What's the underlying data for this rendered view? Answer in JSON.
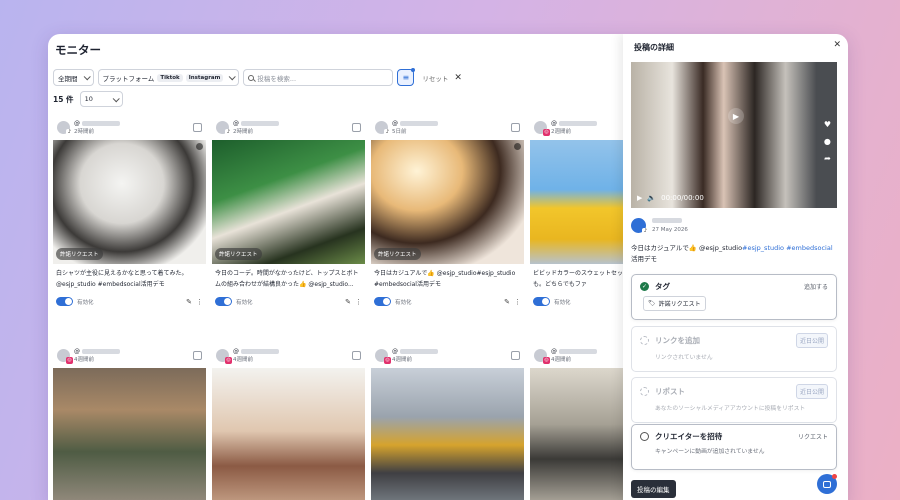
{
  "page": {
    "title": "モニター"
  },
  "filters": {
    "period": "全期間",
    "platform_label": "プラットフォーム",
    "platform_chips": [
      "Tiktok",
      "Instagram"
    ],
    "search_placeholder": "投稿を検索...",
    "reset": "リセット"
  },
  "results": {
    "count": "15 件",
    "per_page": "10"
  },
  "cards": [
    {
      "user": "@",
      "time": "2時間前",
      "platform": "tiktok",
      "badge": "許諾リクエスト",
      "caption": "白シャツが主役に見えるかなと思って着てみた。@esjp_studio #embedsocial活用デモ",
      "enabled": "有効化"
    },
    {
      "user": "@",
      "time": "2時間前",
      "platform": "tiktok",
      "badge": "許諾リクエスト",
      "caption": "今日のコーデ。時間がなかったけど、トップスとボトムの組み合わせが結構良かった👍 @esjp_studio...",
      "enabled": "有効化"
    },
    {
      "user": "@",
      "time": "5日前",
      "platform": "tiktok",
      "badge": "許諾リクエスト",
      "caption": "今日はカジュアルで👍 @esjp_studio#esjp_studio #embedsocial活用デモ",
      "enabled": "有効化"
    },
    {
      "user": "@",
      "time": "2週間前",
      "platform": "instagram",
      "badge": "",
      "caption": "ビビッドカラーのスウェットセットでもスポーツでも。どちらでもファ",
      "enabled": "有効化"
    },
    {
      "user": "@",
      "time": "4週間前",
      "platform": "instagram",
      "badge": "",
      "caption": "",
      "enabled": ""
    },
    {
      "user": "@",
      "time": "4週間前",
      "platform": "instagram",
      "badge": "",
      "caption": "",
      "enabled": ""
    },
    {
      "user": "@",
      "time": "4週間前",
      "platform": "instagram",
      "badge": "",
      "caption": "",
      "enabled": ""
    },
    {
      "user": "@",
      "time": "4週間前",
      "platform": "instagram",
      "badge": "",
      "caption": "",
      "enabled": ""
    }
  ],
  "panel": {
    "title": "投稿の詳細",
    "video_time": "00:00/00:00",
    "date": "27 May 2026",
    "caption_plain": "今日はカジュアルで👍 @esjp_studio",
    "caption_tags": "#esjp_studio #embedsocial",
    "caption_end": "活用デモ",
    "sections": {
      "tag": {
        "title": "タグ",
        "action": "追加する",
        "chip": "許諾リクエスト"
      },
      "link": {
        "title": "リンクを追加",
        "sub": "リンクされていません",
        "action": "近日公開"
      },
      "repost": {
        "title": "リポスト",
        "sub": "あなたのソーシャルメディアアカウントに投稿をリポスト",
        "action": "近日公開"
      },
      "invite": {
        "title": "クリエイターを招待",
        "sub": "キャンペーンに動画が追加されていません",
        "action": "リクエスト"
      }
    },
    "edit_button": "投稿の編集"
  },
  "icons": {
    "filter": "sliders-icon",
    "chat": "chat-bubble-icon",
    "accent": "#2f6fd6"
  }
}
